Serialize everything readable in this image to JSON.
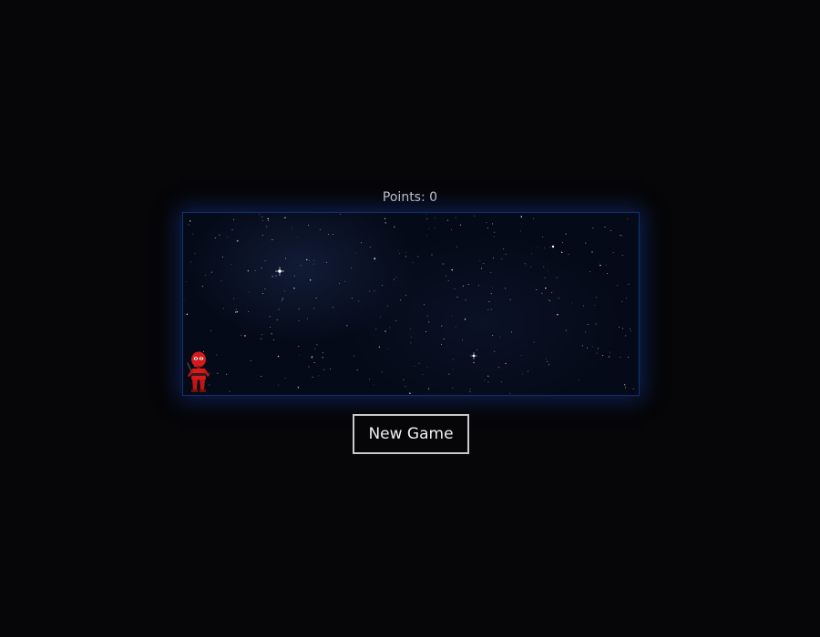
{
  "score": {
    "label": "Points:",
    "value": "0"
  },
  "board": {
    "background": "#050a18",
    "border_color": "#12306e",
    "glow_color": "#1437a0"
  },
  "player": {
    "character": "red-ninja-sprite",
    "color": "#d61a1a"
  },
  "controls": {
    "new_game_label": "New Game"
  },
  "colors": {
    "page_background": "#060608",
    "text": "#c8c8cc",
    "button_border": "#c9c9cc"
  }
}
